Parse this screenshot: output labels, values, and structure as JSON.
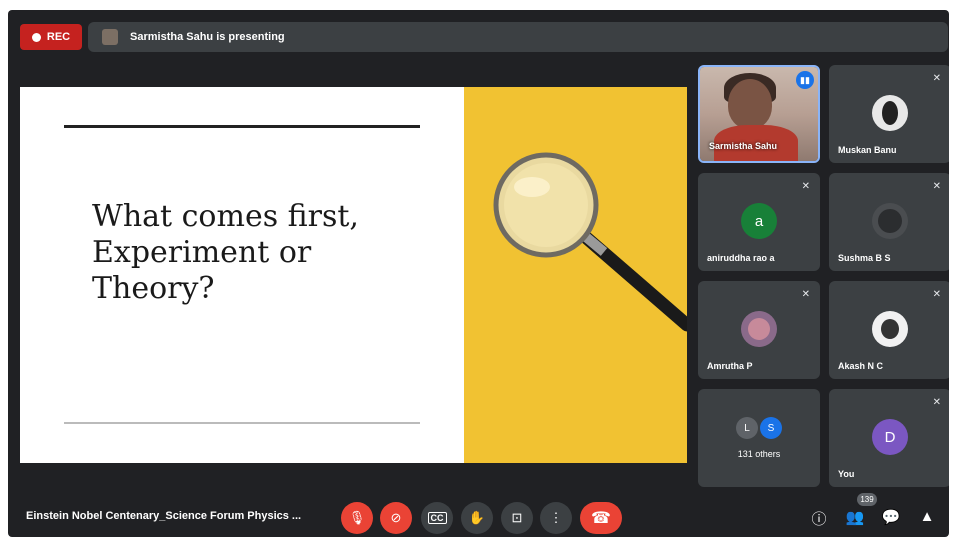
{
  "top": {
    "rec_label": "REC",
    "presenting_text": "Sarmistha Sahu is presenting"
  },
  "slide": {
    "title_lines": [
      "What comes first,",
      "Experiment or",
      "Theory?"
    ]
  },
  "participants": [
    {
      "name": "Sarmistha Sahu",
      "speaking": true
    },
    {
      "name": "Muskan Banu",
      "muted": true
    },
    {
      "name": "aniruddha rao a",
      "initial": "a",
      "color": "#188038",
      "muted": true
    },
    {
      "name": "Sushma B S",
      "muted": true
    },
    {
      "name": "Amrutha P",
      "muted": true
    },
    {
      "name": "Akash N C",
      "muted": true
    },
    {
      "name": "131 others",
      "initials": [
        "L",
        "S"
      ],
      "colors": [
        "#5f6368",
        "#1a73e8"
      ]
    },
    {
      "name": "You",
      "initial": "D",
      "color": "#7b57c2",
      "muted": true
    }
  ],
  "bottom": {
    "meeting_title": "Einstein Nobel Centenary_Science Forum Physics ...",
    "people_count": "139",
    "controls": [
      "mic-off",
      "camera-off",
      "captions",
      "raise-hand",
      "present",
      "more",
      "end-call"
    ]
  },
  "colors": {
    "background": "#202124",
    "tile": "#3c4043",
    "danger": "#ea4335",
    "slide_accent": "#f1c232"
  }
}
